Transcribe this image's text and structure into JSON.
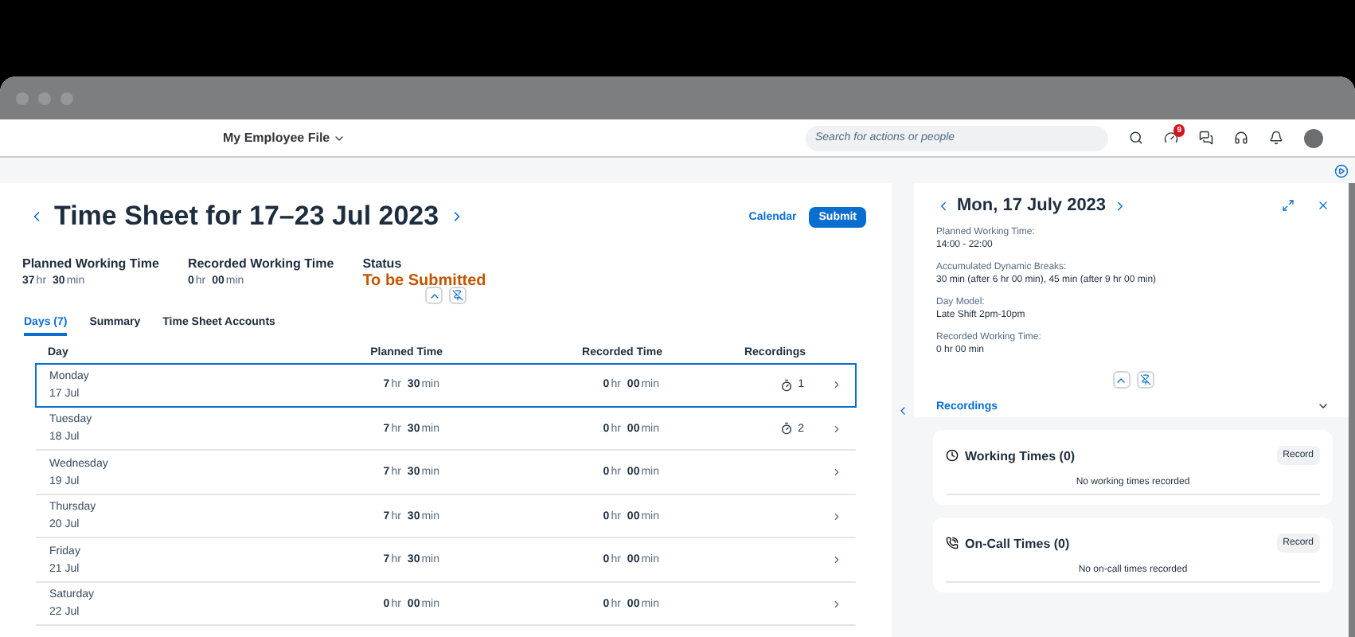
{
  "shell": {
    "title": "My Employee File",
    "search": {
      "placeholder": "Search for actions or people"
    },
    "badge": "9"
  },
  "header": {
    "title": "Time Sheet for 17–23 Jul 2023",
    "calendar": "Calendar",
    "submit": "Submit"
  },
  "kpis": [
    {
      "label": "Planned Working Time",
      "value": [
        "37",
        "hr",
        "30",
        "min"
      ]
    },
    {
      "label": "Recorded Working Time",
      "value": [
        "0",
        "hr",
        "00",
        "min"
      ]
    }
  ],
  "status": {
    "label": "Status",
    "value": "To be Submitted"
  },
  "tabs": [
    {
      "label": "Days (7)",
      "selected": true
    },
    {
      "label": "Summary",
      "selected": false
    },
    {
      "label": "Time Sheet Accounts",
      "selected": false
    }
  ],
  "table": {
    "columns": [
      "Day",
      "Planned Time",
      "Recorded Time",
      "Recordings"
    ],
    "rows": [
      {
        "day": "Monday",
        "date": "17 Jul",
        "planned": [
          "7",
          "hr",
          "30",
          "min"
        ],
        "recorded": [
          "0",
          "hr",
          "00",
          "min"
        ],
        "recordings": "1",
        "selected": true
      },
      {
        "day": "Tuesday",
        "date": "18 Jul",
        "planned": [
          "7",
          "hr",
          "30",
          "min"
        ],
        "recorded": [
          "0",
          "hr",
          "00",
          "min"
        ],
        "recordings": "2",
        "selected": false
      },
      {
        "day": "Wednesday",
        "date": "19 Jul",
        "planned": [
          "7",
          "hr",
          "30",
          "min"
        ],
        "recorded": [
          "0",
          "hr",
          "00",
          "min"
        ],
        "selected": false
      },
      {
        "day": "Thursday",
        "date": "20 Jul",
        "planned": [
          "7",
          "hr",
          "30",
          "min"
        ],
        "recorded": [
          "0",
          "hr",
          "00",
          "min"
        ],
        "selected": false
      },
      {
        "day": "Friday",
        "date": "21 Jul",
        "planned": [
          "7",
          "hr",
          "30",
          "min"
        ],
        "recorded": [
          "0",
          "hr",
          "00",
          "min"
        ],
        "selected": false
      },
      {
        "day": "Saturday",
        "date": "22 Jul",
        "planned": [
          "0",
          "hr",
          "00",
          "min"
        ],
        "recorded": [
          "0",
          "hr",
          "00",
          "min"
        ],
        "selected": false
      }
    ]
  },
  "detail": {
    "title": "Mon, 17 July 2023",
    "fields": [
      {
        "label": "Planned Working Time:",
        "value": "14:00 - 22:00"
      },
      {
        "label": "Accumulated Dynamic Breaks:",
        "value": "30 min (after 6 hr 00 min), 45 min (after 9 hr 00 min)"
      },
      {
        "label": "Day Model:",
        "value": "Late Shift 2pm-10pm"
      },
      {
        "label": "Recorded Working Time:",
        "value": "0 hr 00 min"
      }
    ],
    "section": "Recordings",
    "cards": [
      {
        "kind": "clock",
        "title": "Working Times (0)",
        "button": "Record",
        "empty": "No working times recorded"
      },
      {
        "kind": "phone",
        "title": "On-Call Times (0)",
        "button": "Record",
        "empty": "No on-call times recorded"
      }
    ]
  }
}
